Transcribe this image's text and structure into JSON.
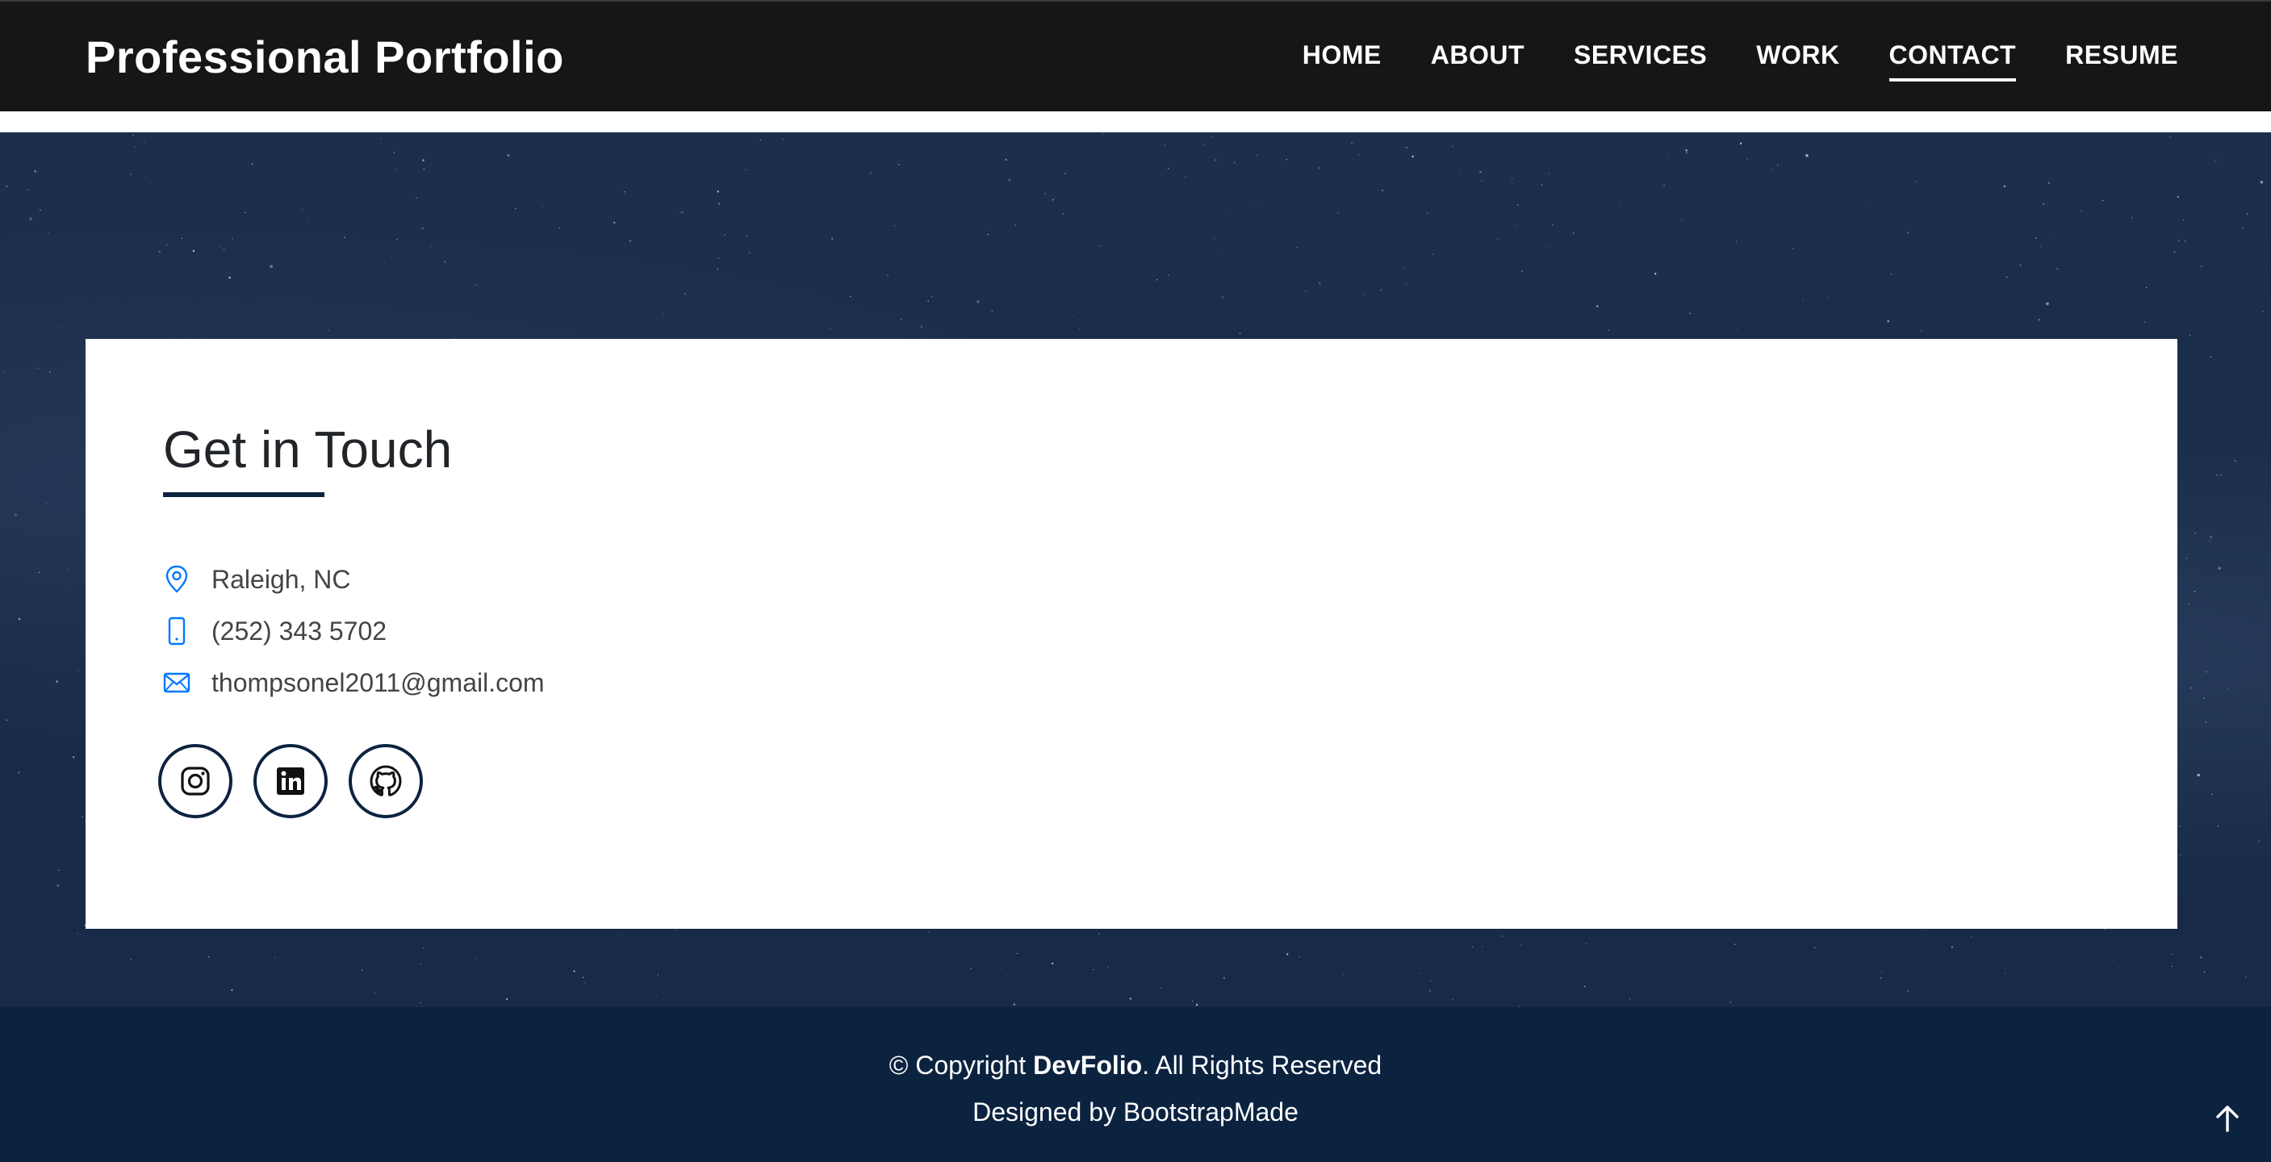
{
  "header": {
    "brand": "Professional Portfolio",
    "nav": [
      {
        "label": "HOME"
      },
      {
        "label": "ABOUT"
      },
      {
        "label": "SERVICES"
      },
      {
        "label": "WORK"
      },
      {
        "label": "CONTACT",
        "active": true
      },
      {
        "label": "RESUME"
      }
    ]
  },
  "contact": {
    "title": "Get in Touch",
    "location": "Raleigh, NC",
    "phone": "(252) 343 5702",
    "email": "thompsonel2011@gmail.com",
    "socials": [
      {
        "icon": "instagram-icon"
      },
      {
        "icon": "linkedin-icon"
      },
      {
        "icon": "github-icon"
      }
    ]
  },
  "footer": {
    "copyright_prefix": "© Copyright ",
    "copyright_brand": "DevFolio",
    "copyright_suffix": ". All Rights Reserved",
    "credits": "Designed by BootstrapMade"
  },
  "colors": {
    "header_bg": "#161616",
    "footer_bg": "#0c2340",
    "accent_blue": "#0078ff",
    "navy": "#0c2340"
  }
}
